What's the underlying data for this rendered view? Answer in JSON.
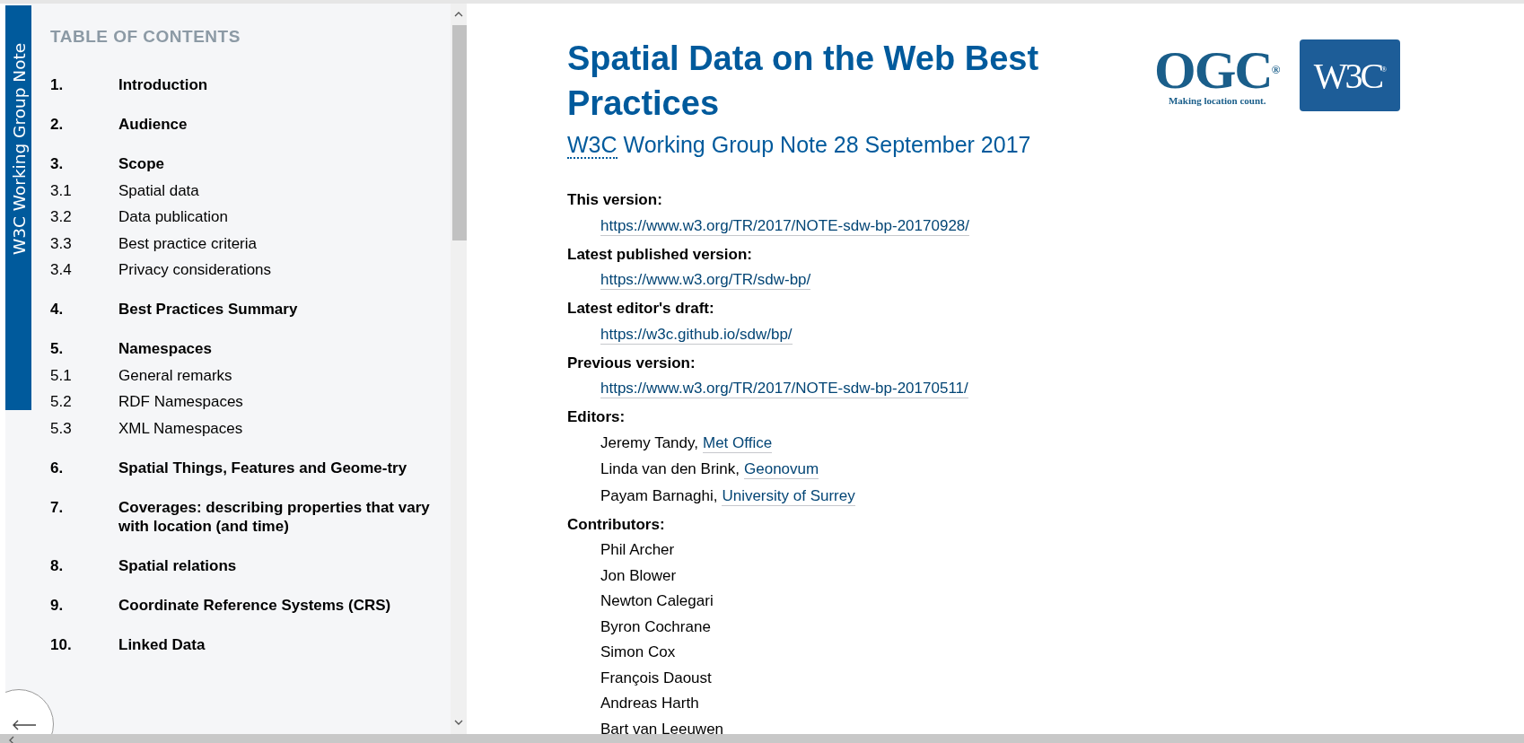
{
  "sidebar": {
    "badge": "W3C Working Group Note",
    "heading": "TABLE OF CONTENTS",
    "items": [
      {
        "number": "1.",
        "title": "Introduction"
      },
      {
        "number": "2.",
        "title": "Audience"
      },
      {
        "number": "3.",
        "title": "Scope",
        "children": [
          {
            "number": "3.1",
            "title": "Spatial data"
          },
          {
            "number": "3.2",
            "title": "Data publication"
          },
          {
            "number": "3.3",
            "title": "Best practice criteria"
          },
          {
            "number": "3.4",
            "title": "Privacy considerations"
          }
        ]
      },
      {
        "number": "4.",
        "title": "Best Practices Summary"
      },
      {
        "number": "5.",
        "title": "Namespaces",
        "children": [
          {
            "number": "5.1",
            "title": "General remarks"
          },
          {
            "number": "5.2",
            "title": "RDF Namespaces"
          },
          {
            "number": "5.3",
            "title": "XML Namespaces"
          }
        ]
      },
      {
        "number": "6.",
        "title": "Spatial Things, Features and Geome-try"
      },
      {
        "number": "7.",
        "title": "Coverages: describing properties that vary with location (and time)"
      },
      {
        "number": "8.",
        "title": "Spatial relations"
      },
      {
        "number": "9.",
        "title": "Coordinate Reference Systems (CRS)"
      },
      {
        "number": "10.",
        "title": "Linked Data"
      }
    ]
  },
  "document": {
    "title": "Spatial Data on the Web Best Practices",
    "subtitle": {
      "abbr": "W3C",
      "text": "Working Group Note 28 September 2017"
    },
    "logos": {
      "ogc": {
        "name": "OGC",
        "mark": "®",
        "tagline": "Making location count."
      },
      "w3c": {
        "name": "W3C",
        "mark": "®"
      }
    },
    "metadata": [
      {
        "label": "This version:",
        "entries": [
          {
            "link": "https://www.w3.org/TR/2017/NOTE-sdw-bp-20170928/"
          }
        ]
      },
      {
        "label": "Latest published version:",
        "entries": [
          {
            "link": "https://www.w3.org/TR/sdw-bp/"
          }
        ]
      },
      {
        "label": "Latest editor's draft:",
        "entries": [
          {
            "link": "https://w3c.github.io/sdw/bp/"
          }
        ]
      },
      {
        "label": "Previous version:",
        "entries": [
          {
            "link": "https://www.w3.org/TR/2017/NOTE-sdw-bp-20170511/"
          }
        ]
      },
      {
        "label": "Editors:",
        "entries": [
          {
            "text": "Jeremy Tandy,",
            "link": "Met Office"
          },
          {
            "text": "Linda van den Brink,",
            "link": "Geonovum"
          },
          {
            "text": "Payam Barnaghi,",
            "link": "University of Surrey"
          }
        ]
      },
      {
        "label": "Contributors:",
        "entries": [
          {
            "text": "Phil Archer"
          },
          {
            "text": "Jon Blower"
          },
          {
            "text": "Newton Calegari"
          },
          {
            "text": "Byron Cochrane"
          },
          {
            "text": "Simon Cox"
          },
          {
            "text": "François Daoust"
          },
          {
            "text": "Andreas Harth"
          },
          {
            "text": "Bart van Leeuwen"
          }
        ]
      }
    ]
  }
}
